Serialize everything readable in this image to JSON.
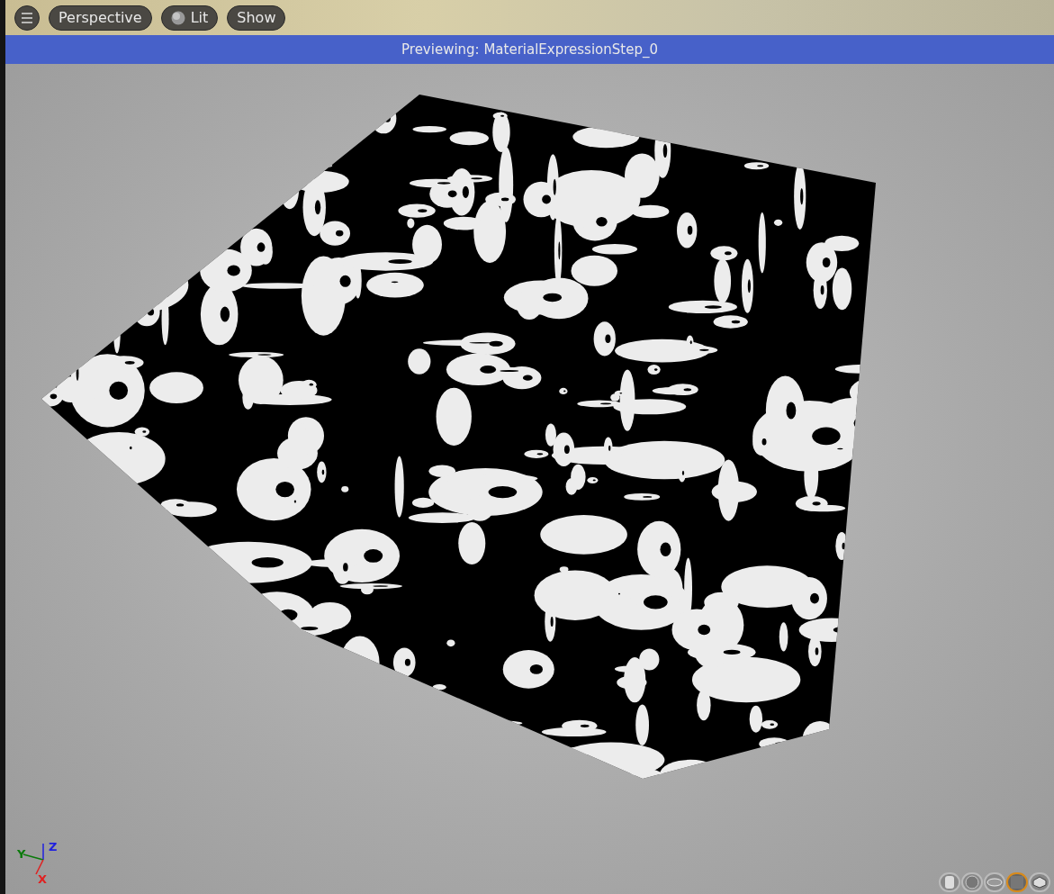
{
  "toolbar": {
    "buttons": [
      {
        "kind": "menu"
      },
      {
        "kind": "text",
        "label": "Perspective"
      },
      {
        "kind": "lit",
        "label": "Lit"
      },
      {
        "kind": "text",
        "label": "Show"
      }
    ]
  },
  "banner": {
    "text": "Previewing: MaterialExpressionStep_0"
  },
  "gizmo": {
    "axes": [
      {
        "label": "Z",
        "color": "#2020e0"
      },
      {
        "label": "Y",
        "color": "#0a7a0a"
      },
      {
        "label": "X",
        "color": "#e02020"
      }
    ]
  },
  "preview_shapes": [
    {
      "kind": "cylinder",
      "selected": false
    },
    {
      "kind": "sphere",
      "selected": false
    },
    {
      "kind": "plane",
      "selected": false
    },
    {
      "kind": "cube",
      "selected": true
    },
    {
      "kind": "mesh",
      "selected": false
    }
  ]
}
